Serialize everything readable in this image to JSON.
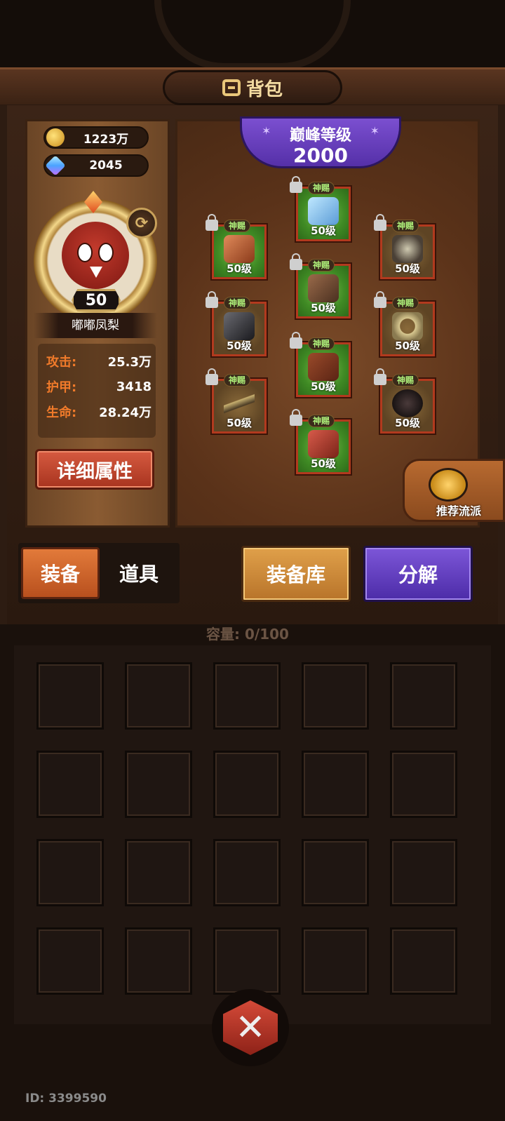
{
  "header": {
    "title": "背包",
    "icon": "backpack-icon"
  },
  "currency": {
    "gold": "1223万",
    "gems": "2045"
  },
  "hero": {
    "level": "50",
    "name": "嘟嘟凤梨",
    "attributes": [
      {
        "label": "攻击:",
        "value": "25.3万"
      },
      {
        "label": "护甲:",
        "value": "3418"
      },
      {
        "label": "生命:",
        "value": "28.24万"
      }
    ],
    "detail_button": "详细属性"
  },
  "peak": {
    "label": "巅峰等级",
    "value": "2000"
  },
  "equipment_slots": [
    {
      "name": "helmet",
      "tag": "神赐",
      "level": "50级",
      "icon": "helmet-icon"
    },
    {
      "name": "shoulder",
      "tag": "神赐",
      "level": "50级",
      "icon": "shoulder-icon"
    },
    {
      "name": "necklace",
      "tag": "神赐",
      "level": "50级",
      "icon": "necklace-icon"
    },
    {
      "name": "armor",
      "tag": "神赐",
      "level": "50级",
      "icon": "armor-icon"
    },
    {
      "name": "gauntlet",
      "tag": "神赐",
      "level": "50级",
      "icon": "gauntlet-icon"
    },
    {
      "name": "ring",
      "tag": "神赐",
      "level": "50级",
      "icon": "ring-icon"
    },
    {
      "name": "pants",
      "tag": "神赐",
      "level": "50级",
      "icon": "pants-icon"
    },
    {
      "name": "weapon",
      "tag": "神赐",
      "level": "50级",
      "icon": "gun-icon"
    },
    {
      "name": "bomb",
      "tag": "神赐",
      "level": "50级",
      "icon": "bomb-icon"
    },
    {
      "name": "boots",
      "tag": "神赐",
      "level": "50级",
      "icon": "boots-icon"
    }
  ],
  "recommend": {
    "label": "推荐流派"
  },
  "tabs": [
    {
      "label": "装备",
      "active": true
    },
    {
      "label": "道具",
      "active": false
    }
  ],
  "actions": {
    "storage": "装备库",
    "decompose": "分解"
  },
  "capacity": "容量: 0/100",
  "user_id": "ID: 3399590",
  "colors": {
    "accent_orange": "#e27a3a",
    "accent_purple": "#6a44c4",
    "stat_label": "#f07a2a"
  }
}
